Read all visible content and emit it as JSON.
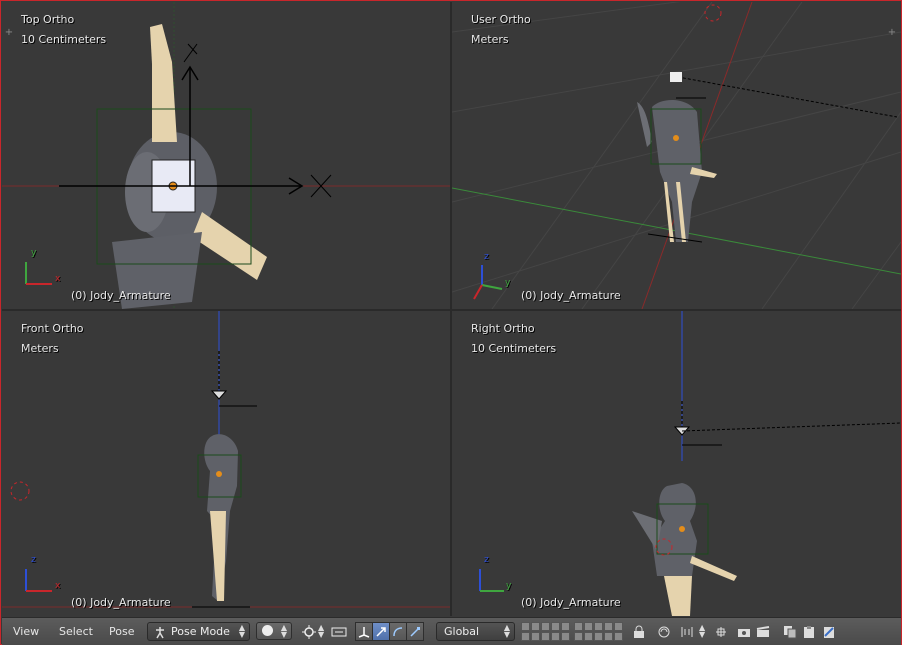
{
  "viewports": {
    "top_left": {
      "title": "Top Ortho",
      "units": "10 Centimeters",
      "object": "(0) Jody_Armature",
      "axis_a": "x",
      "axis_b": "y"
    },
    "top_right": {
      "title": "User Ortho",
      "units": "Meters",
      "object": "(0) Jody_Armature",
      "axis_a": "y",
      "axis_b": "z"
    },
    "bottom_left": {
      "title": "Front Ortho",
      "units": "Meters",
      "object": "(0) Jody_Armature",
      "axis_a": "x",
      "axis_b": "z"
    },
    "bottom_right": {
      "title": "Right Ortho",
      "units": "10 Centimeters",
      "object": "(0) Jody_Armature",
      "axis_a": "y",
      "axis_b": "z"
    }
  },
  "header": {
    "menu": {
      "view": "View",
      "select": "Select",
      "pose": "Pose"
    },
    "mode": "Pose Mode",
    "orientation": "Global"
  },
  "colors": {
    "x_axis": "#c9262b",
    "y_axis": "#3fa63f",
    "z_axis": "#2d4fd6",
    "window_border": "#c9262b",
    "active_button": "#5a7bb8"
  },
  "icons": [
    "viewport-shading-icon",
    "pivot-icon",
    "manipulator-icon",
    "translate-icon",
    "rotate-icon",
    "scale-icon",
    "layers-icon",
    "lock-icon",
    "onion-icon",
    "render-icon",
    "copy-pose-icon",
    "paste-pose-icon",
    "paste-flipped-icon"
  ]
}
